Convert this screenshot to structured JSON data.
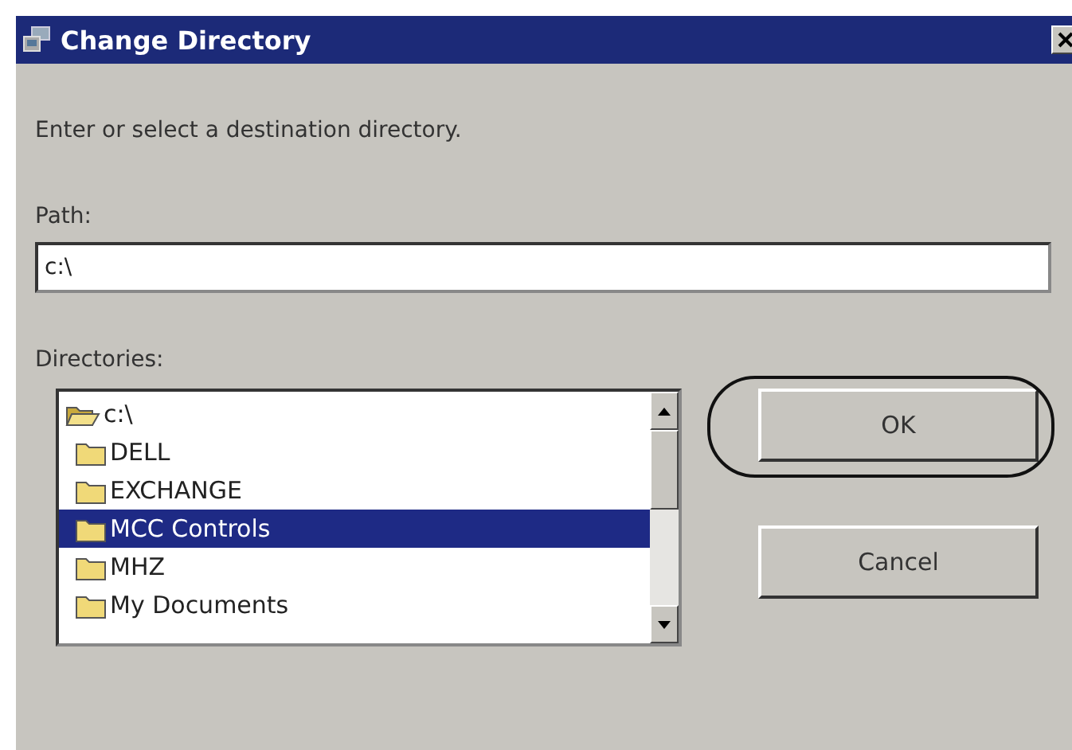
{
  "window": {
    "title": "Change Directory"
  },
  "prompt": "Enter or select a destination directory.",
  "path": {
    "label": "Path:",
    "value": "c:\\"
  },
  "directories": {
    "label": "Directories:",
    "items": [
      {
        "name": "c:\\",
        "kind": "open",
        "selected": false,
        "children": [
          {
            "name": "DELL",
            "kind": "closed",
            "selected": false
          },
          {
            "name": "EXCHANGE",
            "kind": "closed",
            "selected": false
          },
          {
            "name": "MCC Controls",
            "kind": "closed",
            "selected": true
          },
          {
            "name": "MHZ",
            "kind": "closed",
            "selected": false
          },
          {
            "name": "My Documents",
            "kind": "closed",
            "selected": false
          }
        ]
      }
    ]
  },
  "buttons": [
    {
      "label": "OK",
      "circled": true
    },
    {
      "label": "Cancel",
      "circled": false
    }
  ]
}
